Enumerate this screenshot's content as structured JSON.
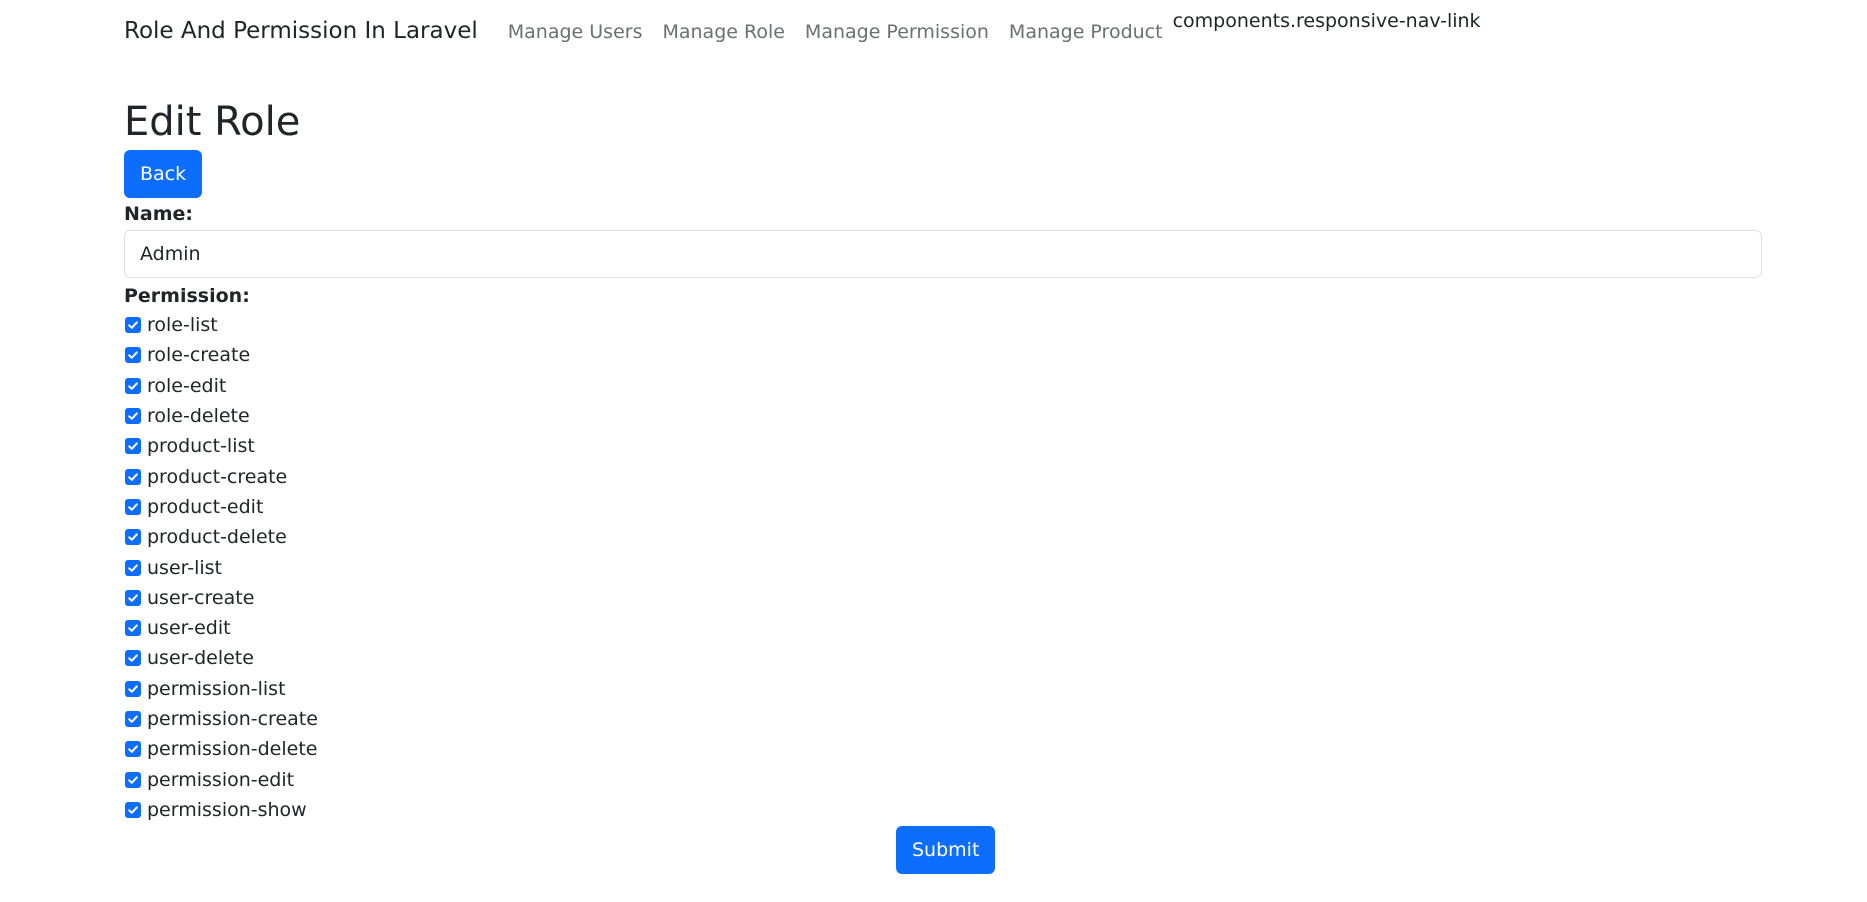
{
  "navbar": {
    "brand": "Role And Permission In Laravel",
    "links": [
      "Manage Users",
      "Manage Role",
      "Manage Permission",
      "Manage Product"
    ],
    "raw_text": "components.responsive-nav-link"
  },
  "page": {
    "title": "Edit Role",
    "back_label": "Back"
  },
  "form": {
    "name_label": "Name:",
    "name_value": "Admin",
    "permission_label": "Permission:",
    "permissions": [
      {
        "label": "role-list",
        "checked": true
      },
      {
        "label": "role-create",
        "checked": true
      },
      {
        "label": "role-edit",
        "checked": true
      },
      {
        "label": "role-delete",
        "checked": true
      },
      {
        "label": "product-list",
        "checked": true
      },
      {
        "label": "product-create",
        "checked": true
      },
      {
        "label": "product-edit",
        "checked": true
      },
      {
        "label": "product-delete",
        "checked": true
      },
      {
        "label": "user-list",
        "checked": true
      },
      {
        "label": "user-create",
        "checked": true
      },
      {
        "label": "user-edit",
        "checked": true
      },
      {
        "label": "user-delete",
        "checked": true
      },
      {
        "label": "permission-list",
        "checked": true
      },
      {
        "label": "permission-create",
        "checked": true
      },
      {
        "label": "permission-delete",
        "checked": true
      },
      {
        "label": "permission-edit",
        "checked": true
      },
      {
        "label": "permission-show",
        "checked": true
      }
    ],
    "submit_label": "Submit"
  },
  "colors": {
    "primary": "#0d6efd",
    "nav_link": "#6c6f73",
    "text": "#212529"
  },
  "icons": {
    "checkbox": "check-icon"
  }
}
